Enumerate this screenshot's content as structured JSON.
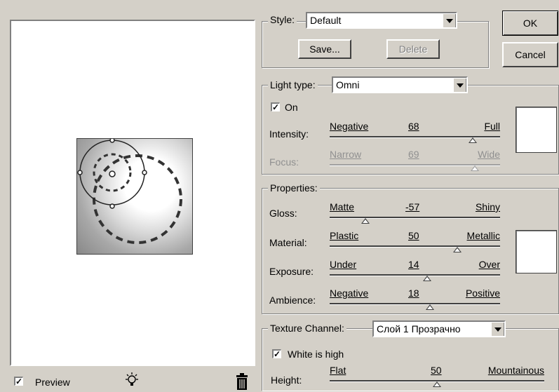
{
  "style": {
    "label": "Style:",
    "value": "Default",
    "save_label": "Save...",
    "delete_label": "Delete"
  },
  "dialog": {
    "ok_label": "OK",
    "cancel_label": "Cancel"
  },
  "light": {
    "type_label": "Light type:",
    "type_value": "Omni",
    "on_label": "On",
    "on_checked": true,
    "intensity": {
      "label": "Intensity:",
      "left": "Negative",
      "value": "68",
      "right": "Full",
      "position": 0.84
    },
    "focus": {
      "label": "Focus:",
      "left": "Narrow",
      "value": "69",
      "right": "Wide",
      "position": 0.85,
      "disabled": true
    }
  },
  "properties": {
    "title": "Properties:",
    "gloss": {
      "label": "Gloss:",
      "left": "Matte",
      "value": "-57",
      "right": "Shiny",
      "position": 0.21
    },
    "material": {
      "label": "Material:",
      "left": "Plastic",
      "value": "50",
      "right": "Metallic",
      "position": 0.75
    },
    "exposure": {
      "label": "Exposure:",
      "left": "Under",
      "value": "14",
      "right": "Over",
      "position": 0.57
    },
    "ambience": {
      "label": "Ambience:",
      "left": "Negative",
      "value": "18",
      "right": "Positive",
      "position": 0.59
    }
  },
  "texture": {
    "channel_label": "Texture Channel:",
    "channel_value": "Слой 1 Прозрачно",
    "white_high_label": "White is high",
    "white_high_checked": true,
    "height": {
      "label": "Height:",
      "left": "Flat",
      "value": "50",
      "right": "Mountainous",
      "position": 0.5
    }
  },
  "preview": {
    "label": "Preview",
    "checked": true
  },
  "colors": {
    "dialog_bg": "#d4d0c8",
    "preview_bg": "#ffffff",
    "swatch": "#ffffff"
  },
  "icons": [
    "light-bulb-icon",
    "trash-icon",
    "dropdown-arrow-icon"
  ]
}
